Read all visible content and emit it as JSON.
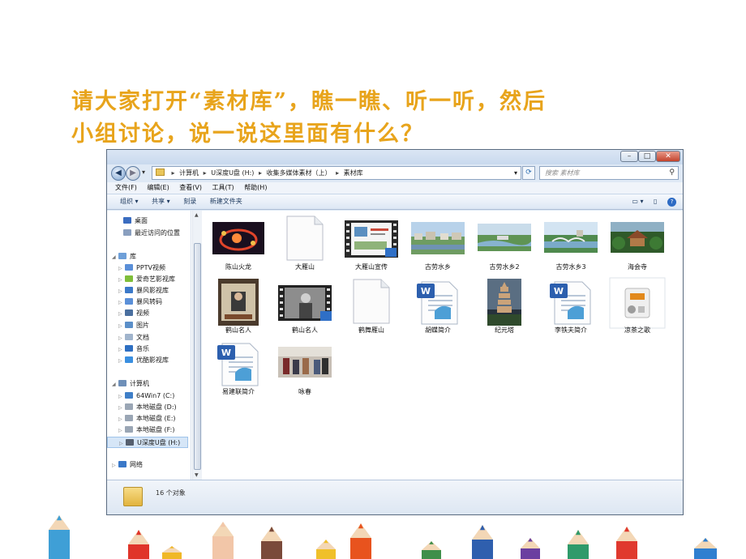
{
  "slide": {
    "title_line1": "请大家打开“素材库”，瞧一瞧、听一听，然后",
    "title_line2": "小组讨论，说一说这里面有什么？"
  },
  "window": {
    "controls": {
      "minimize": "–",
      "maximize": "□",
      "close": "✕"
    },
    "address": {
      "crumbs": [
        "计算机",
        "U深度U盘 (H:)",
        "收集多媒体素材（上）",
        "素材库"
      ]
    },
    "search_placeholder": "搜索 素材库",
    "menu": [
      "文件(F)",
      "编辑(E)",
      "查看(V)",
      "工具(T)",
      "帮助(H)"
    ],
    "toolbar": {
      "organize": "组织 ▾",
      "share": "共享 ▾",
      "burn": "刻录",
      "new_folder": "新建文件夹"
    },
    "nav_pane": [
      {
        "label": "桌面",
        "color": "#3a6cc0"
      },
      {
        "label": "最近访问的位置",
        "color": "#8a9fbf"
      },
      {
        "label": "库",
        "color": "#6e9fd8",
        "group": true
      },
      {
        "label": "PPTV视频",
        "color": "#5a8fd8"
      },
      {
        "label": "爱奇艺影视库",
        "color": "#7fbe3a"
      },
      {
        "label": "暴风影视库",
        "color": "#3b79c9"
      },
      {
        "label": "暴风转码",
        "color": "#5a8fd8"
      },
      {
        "label": "视频",
        "color": "#4a6f9f"
      },
      {
        "label": "图片",
        "color": "#5b8fc9"
      },
      {
        "label": "文档",
        "color": "#a0b4cc"
      },
      {
        "label": "音乐",
        "color": "#2e6fc2"
      },
      {
        "label": "优酷影视库",
        "color": "#3a8fe0"
      },
      {
        "label": "计算机",
        "color": "#6e8fb8",
        "group": true
      },
      {
        "label": "64Win7  (C:)",
        "color": "#3f7fc8"
      },
      {
        "label": "本地磁盘 (D:)",
        "color": "#9aa6b5"
      },
      {
        "label": "本地磁盘 (E:)",
        "color": "#9aa6b5"
      },
      {
        "label": "本地磁盘 (F:)",
        "color": "#9aa6b5"
      },
      {
        "label": "U深度U盘 (H:)",
        "color": "#555f6e",
        "selected": true
      },
      {
        "label": "网络",
        "color": "#3a78c8",
        "group": true
      }
    ],
    "files": [
      {
        "name": "陈山火龙",
        "kind": "photo-fire"
      },
      {
        "name": "大雁山",
        "kind": "blank"
      },
      {
        "name": "大雁山宣传",
        "kind": "video-slide"
      },
      {
        "name": "古劳水乡",
        "kind": "photo-town"
      },
      {
        "name": "古劳水乡2",
        "kind": "photo-aerial"
      },
      {
        "name": "古劳水乡3",
        "kind": "photo-bridge"
      },
      {
        "name": "海会寺",
        "kind": "photo-temple"
      },
      {
        "name": "鹤山名人",
        "kind": "photo-hall"
      },
      {
        "name": "鹤山名人",
        "kind": "video-person"
      },
      {
        "name": "鹤舞雁山",
        "kind": "blank"
      },
      {
        "name": "胡蝶简介",
        "kind": "word"
      },
      {
        "name": "纪元塔",
        "kind": "photo-pagoda"
      },
      {
        "name": "李铁夫简介",
        "kind": "word"
      },
      {
        "name": "凉茶之歌",
        "kind": "audio"
      },
      {
        "name": "易建联简介",
        "kind": "word"
      },
      {
        "name": "咏春",
        "kind": "photo-crowd"
      }
    ],
    "status": "16 个对象"
  }
}
